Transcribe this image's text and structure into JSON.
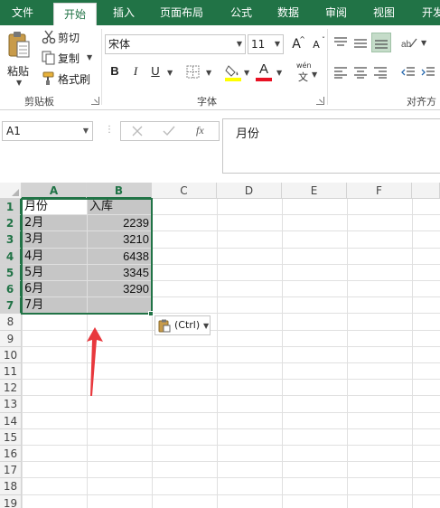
{
  "tabs": [
    {
      "label": "文件",
      "active": false
    },
    {
      "label": "开始",
      "active": true
    },
    {
      "label": "插入",
      "active": false
    },
    {
      "label": "页面布局",
      "active": false
    },
    {
      "label": "公式",
      "active": false
    },
    {
      "label": "数据",
      "active": false
    },
    {
      "label": "审阅",
      "active": false
    },
    {
      "label": "视图",
      "active": false
    },
    {
      "label": "开发",
      "active": false
    }
  ],
  "clipboard": {
    "paste": "粘贴",
    "cut": "剪切",
    "copy": "复制",
    "format_painter": "格式刷",
    "group_label": "剪贴板"
  },
  "font": {
    "name": "宋体",
    "size": "11",
    "grow": "A",
    "shrink": "A",
    "bold": "B",
    "italic": "I",
    "underline": "U",
    "color_letter": "A",
    "phonetic": "wén",
    "phonetic_char": "文",
    "group_label": "字体"
  },
  "alignment": {
    "group_label": "对齐方"
  },
  "formula_bar": {
    "name_box": "A1",
    "fx": "fx",
    "content": "月份"
  },
  "columns": [
    "A",
    "B",
    "C",
    "D",
    "E",
    "F"
  ],
  "rows": [
    "1",
    "2",
    "3",
    "4",
    "5",
    "6",
    "7",
    "8",
    "9",
    "10",
    "11",
    "12",
    "13",
    "14",
    "15",
    "16",
    "17",
    "18",
    "19"
  ],
  "cells": {
    "A1": "月份",
    "B1": "入库",
    "A2": "2月",
    "B2": "2239",
    "A3": "3月",
    "B3": "3210",
    "A4": "4月",
    "B4": "6438",
    "A5": "5月",
    "B5": "3345",
    "A6": "6月",
    "B6": "3290",
    "A7": "7月",
    "B7": ""
  },
  "paste_options": {
    "label": "(Ctrl)"
  },
  "colors": {
    "accent": "#217346",
    "selection_fill": "#c6c6c6",
    "arrow": "#e8383d"
  }
}
